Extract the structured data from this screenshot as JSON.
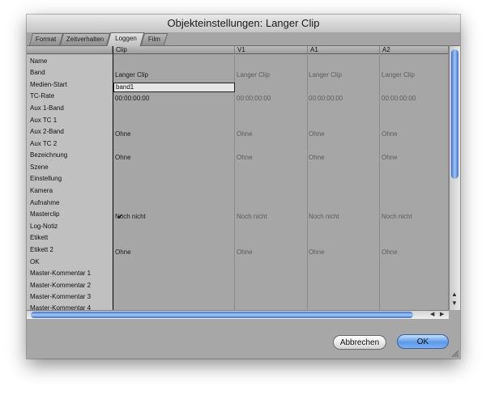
{
  "window": {
    "title": "Objekteinstellungen: Langer Clip"
  },
  "tabs": [
    "Format",
    "Zeitverhalten",
    "Loggen",
    "Film"
  ],
  "active_tab": "Loggen",
  "columns": [
    "Clip",
    "V1",
    "A1",
    "A2"
  ],
  "rows": [
    "Name",
    "Band",
    "Medien-Start",
    "TC-Rate",
    "Aux 1-Band",
    "Aux TC 1",
    "Aux 2-Band",
    "Aux TC 2",
    "Bezeichnung",
    "Szene",
    "Einstellung",
    "Kamera",
    "Aufnahme",
    "Masterclip",
    "Log-Notiz",
    "Etikett",
    "Etikett 2",
    "OK",
    "Master-Kommentar 1",
    "Master-Kommentar 2",
    "Master-Kommentar 3",
    "Master-Kommentar 4"
  ],
  "values": {
    "clip": {
      "name": "Langer Clip",
      "band": "band1",
      "medien_start": "00:00:00:00",
      "aux_tc_1": "Ohne",
      "aux_tc_2": "Ohne",
      "aufnahme": "Noch nicht",
      "etikett": "Ohne"
    },
    "v1": {
      "name": "Langer Clip",
      "medien_start": "00:00:00:00",
      "aux_tc_1": "Ohne",
      "aux_tc_2": "Ohne",
      "aufnahme": "Noch nicht",
      "etikett": "Ohne"
    },
    "a1": {
      "name": "Langer Clip",
      "medien_start": "00:00:00:00",
      "aux_tc_1": "Ohne",
      "aux_tc_2": "Ohne",
      "aufnahme": "Noch nicht",
      "etikett": "Ohne"
    },
    "a2": {
      "name": "Langer Clip",
      "medien_start": "00:00:00:00",
      "aux_tc_1": "Ohne",
      "aux_tc_2": "Ohne",
      "aufnahme": "Noch nicht",
      "etikett": "Ohne"
    }
  },
  "masterclip_checked": true,
  "icons": {
    "check": "checkmark-icon",
    "scroll_up": "arrow-up-icon",
    "scroll_down": "arrow-down-icon",
    "scroll_left": "arrow-left-icon",
    "scroll_right": "arrow-right-icon"
  },
  "buttons": {
    "cancel": "Abbrechen",
    "ok": "OK"
  },
  "colors": {
    "ok_button": "#5d99e6",
    "scroll_thumb": "#3f6ec9"
  }
}
